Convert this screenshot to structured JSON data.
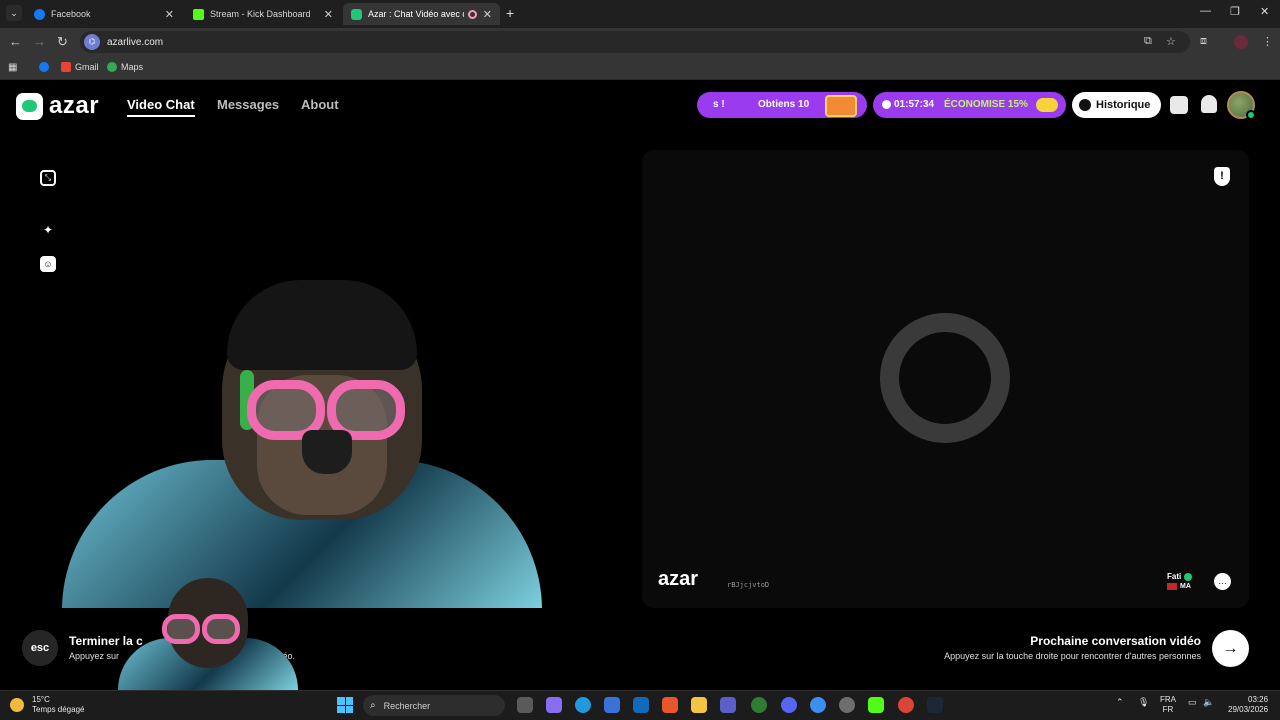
{
  "browser": {
    "tabs": [
      {
        "title": "Facebook"
      },
      {
        "title": "Stream - Kick Dashboard"
      },
      {
        "title": "Azar : Chat Vidéo avec de"
      }
    ],
    "url": "azarlive.com",
    "bookmarks": [
      {
        "label": "Gmail"
      },
      {
        "label": "Maps"
      }
    ]
  },
  "app": {
    "logo": "azar",
    "nav": [
      "Video Chat",
      "Messages",
      "About"
    ],
    "promo1": {
      "left": "s !",
      "right": "Obtiens 10"
    },
    "promo2": {
      "timer": "01:57:34",
      "save": "ÉCONOMISE 15%"
    },
    "history_label": "Historique",
    "remote": {
      "watermark": "azar",
      "watermark_id": "rBJjcjvtoD",
      "peer_name": "Fati",
      "peer_country": "MA"
    },
    "footer": {
      "esc_key": "esc",
      "end_title": "Terminer la c",
      "end_sub_a": "Appuyez sur",
      "end_sub_b": "au chat vidéo.",
      "next_title": "Prochaine conversation vidéo",
      "next_sub": "Appuyez sur la touche droite pour rencontrer d'autres personnes"
    }
  },
  "taskbar": {
    "temp": "15°C",
    "weather": "Temps dégagé",
    "search_placeholder": "Rechercher",
    "lang_top": "FRA",
    "lang_bottom": "FR",
    "time": "03:26",
    "date": "29/03/2026"
  },
  "colors": {
    "brand_green": "#1ec878",
    "promo_purple": "#9b3bef",
    "mask_pink": "#f06ab0"
  }
}
